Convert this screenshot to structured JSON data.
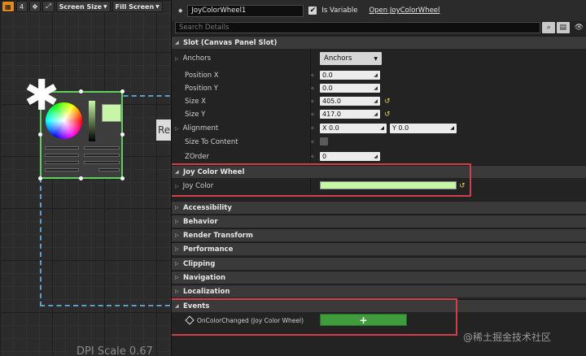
{
  "toolbar": {
    "number_label": "4",
    "screen_size_label": "Screen Size",
    "fill_screen_label": "Fill Screen"
  },
  "canvas": {
    "preview_tab_text": "Re",
    "dpi_scale_text": "DPI Scale 0.67"
  },
  "details": {
    "widget_name": "JoyColorWheel1",
    "is_variable_label": "Is Variable",
    "open_link": "Open JoyColorWheel",
    "search_placeholder": "Search Details",
    "slot_header": "Slot (Canvas Panel Slot)",
    "anchors_label": "Anchors",
    "anchors_value": "Anchors",
    "position_x_label": "Position X",
    "position_x_value": "0.0",
    "position_y_label": "Position Y",
    "position_y_value": "0.0",
    "size_x_label": "Size X",
    "size_x_value": "405.0",
    "size_y_label": "Size Y",
    "size_y_value": "417.0",
    "alignment_label": "Alignment",
    "alignment_x": "X  0.0",
    "alignment_y": "Y  0.0",
    "size_to_content_label": "Size To Content",
    "zorder_label": "ZOrder",
    "zorder_value": "0",
    "joy_header": "Joy Color Wheel",
    "joy_color_label": "Joy Color",
    "joy_color_hex": "#c7f7a6",
    "categories": [
      "Accessibility",
      "Behavior",
      "Render Transform",
      "Performance",
      "Clipping",
      "Navigation",
      "Localization"
    ],
    "events_header": "Events",
    "event_label": "OnColorChanged (Joy Color Wheel)",
    "add_event_label": "+"
  },
  "watermark_text": "@稀土掘金技术社区"
}
